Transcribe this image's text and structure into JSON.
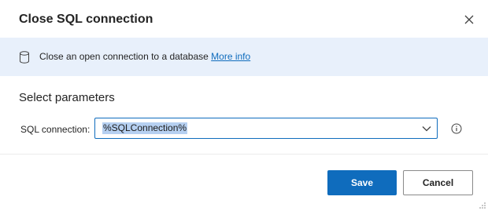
{
  "dialog": {
    "title": "Close SQL connection",
    "close_icon": "close-icon"
  },
  "banner": {
    "icon": "database-icon",
    "text": "Close an open connection to a database",
    "link_label": "More info"
  },
  "parameters": {
    "section_title": "Select parameters",
    "sql_connection": {
      "label": "SQL connection:",
      "value": "%SQLConnection%",
      "chevron_icon": "chevron-down-icon",
      "help_icon": "info-icon"
    }
  },
  "footer": {
    "save_label": "Save",
    "cancel_label": "Cancel"
  },
  "colors": {
    "accent": "#0f6cbd",
    "banner_background": "#e8f0fb",
    "selection_highlight": "#b6d0f1"
  }
}
